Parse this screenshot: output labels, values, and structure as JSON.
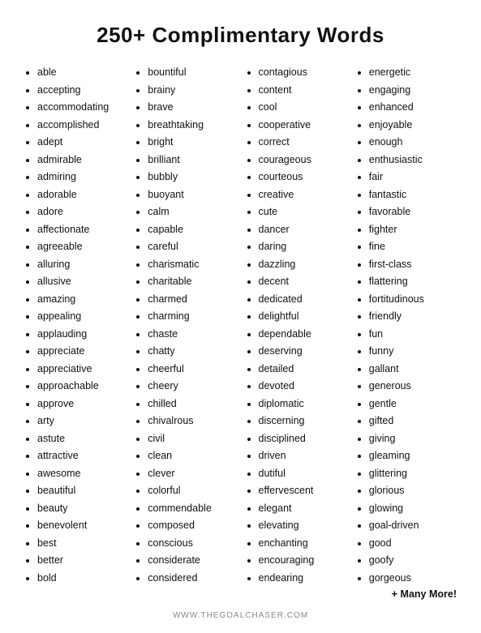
{
  "title": "250+ Complimentary Words",
  "footer": "WWW.THEGOALCHASER.COM",
  "more_label": "+ Many More!",
  "columns": [
    {
      "id": "col1",
      "items": [
        "able",
        "accepting",
        "accommodating",
        "accomplished",
        "adept",
        "admirable",
        "admiring",
        "adorable",
        "adore",
        "affectionate",
        "agreeable",
        "alluring",
        "allusive",
        "amazing",
        "appealing",
        "applauding",
        "appreciate",
        "appreciative",
        "approachable",
        "approve",
        "arty",
        "astute",
        "attractive",
        "awesome",
        "beautiful",
        "beauty",
        "benevolent",
        "best",
        "better",
        "bold"
      ]
    },
    {
      "id": "col2",
      "items": [
        "bountiful",
        "brainy",
        "brave",
        "breathtaking",
        "bright",
        "brilliant",
        "bubbly",
        "buoyant",
        "calm",
        "capable",
        "careful",
        "charismatic",
        "charitable",
        "charmed",
        "charming",
        "chaste",
        "chatty",
        "cheerful",
        "cheery",
        "chilled",
        "chivalrous",
        "civil",
        "clean",
        "clever",
        "colorful",
        "commendable",
        "composed",
        "conscious",
        "considerate",
        "considered"
      ]
    },
    {
      "id": "col3",
      "items": [
        "contagious",
        "content",
        "cool",
        "cooperative",
        "correct",
        "courageous",
        "courteous",
        "creative",
        "cute",
        "dancer",
        "daring",
        "dazzling",
        "decent",
        "dedicated",
        "delightful",
        "dependable",
        "deserving",
        "detailed",
        "devoted",
        "diplomatic",
        "discerning",
        "disciplined",
        "driven",
        "dutiful",
        "effervescent",
        "elegant",
        "elevating",
        "enchanting",
        "encouraging",
        "endearing"
      ]
    },
    {
      "id": "col4",
      "items": [
        "energetic",
        "engaging",
        "enhanced",
        "enjoyable",
        "enough",
        "enthusiastic",
        "fair",
        "fantastic",
        "favorable",
        "fighter",
        "fine",
        "first-class",
        "flattering",
        "fortitudinous",
        "friendly",
        "fun",
        "funny",
        "gallant",
        "generous",
        "gentle",
        "gifted",
        "giving",
        "gleaming",
        "glittering",
        "glorious",
        "glowing",
        "goal-driven",
        "good",
        "goofy",
        "gorgeous"
      ]
    }
  ]
}
